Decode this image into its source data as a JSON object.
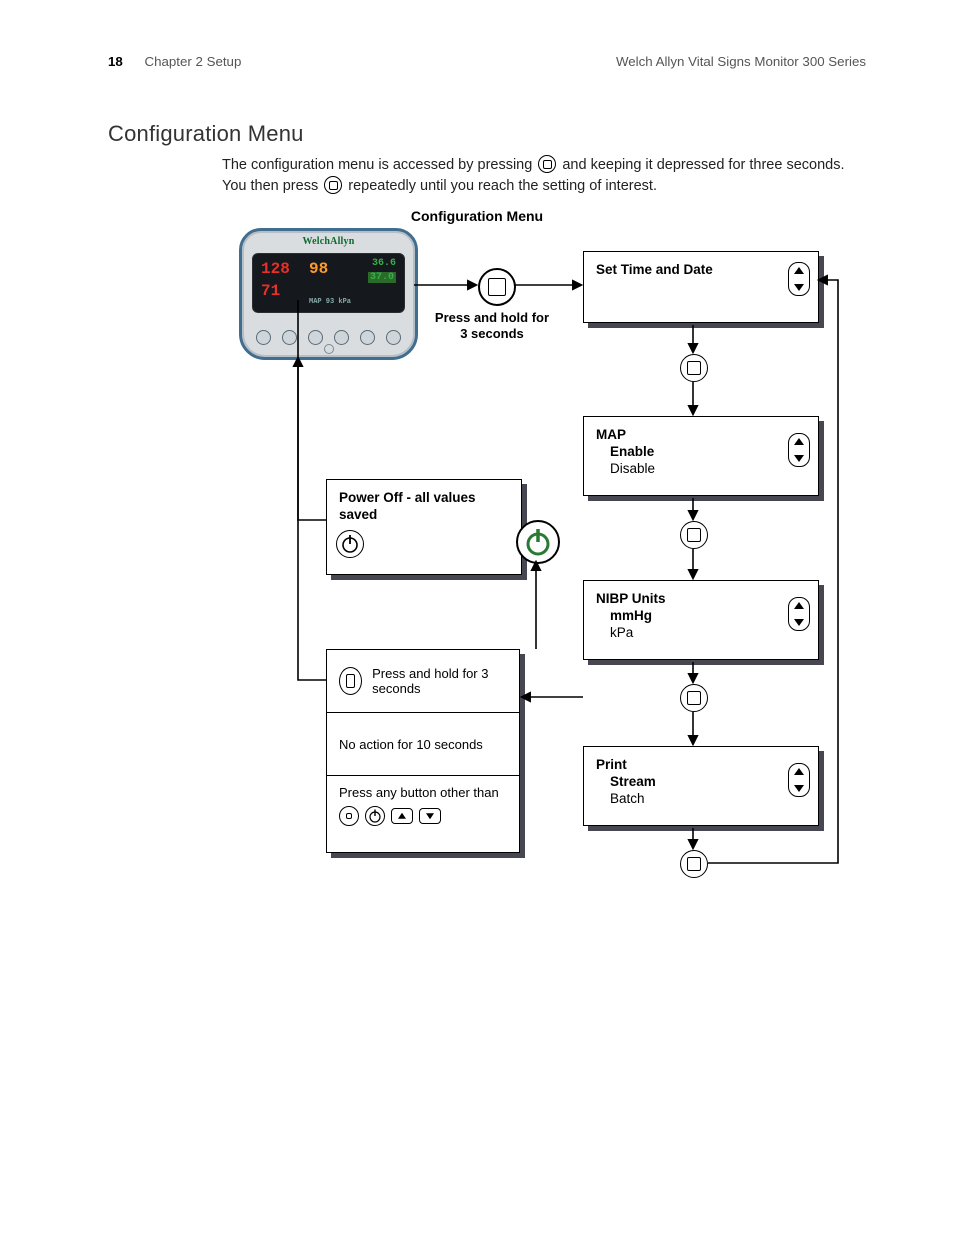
{
  "header": {
    "page": "18",
    "chapter": "Chapter 2   Setup",
    "product": "Welch Allyn Vital Signs Monitor 300 Series"
  },
  "title": "Configuration Menu",
  "intro": {
    "a": "The configuration menu is accessed by pressing ",
    "b": " and keeping it depressed for three seconds. You then press ",
    "c": " repeatedly until you reach the setting of interest."
  },
  "figTitle": "Configuration Menu",
  "pressHold": "Press and hold for 3 seconds",
  "menu": {
    "n1": {
      "t": "Set Time and Date"
    },
    "n2": {
      "t": "MAP",
      "o1": "Enable",
      "o2": "Disable"
    },
    "n3": {
      "t": "NIBP Units",
      "o1": "mmHg",
      "o2": "kPa"
    },
    "n4": {
      "t": "Print",
      "o1": "Stream",
      "o2": "Batch"
    }
  },
  "poff": "Power Off - all values saved",
  "cells": {
    "c1": "Press and hold for 3 seconds",
    "c2": "No action for 10 seconds",
    "c3": "Press any button other than"
  },
  "device": {
    "brand": "WelchAllyn",
    "sys": "128",
    "spo2": "98",
    "temp1": "36.6",
    "temp2": "37.0",
    "dia": "71",
    "note": "MAP 93 kPa"
  }
}
